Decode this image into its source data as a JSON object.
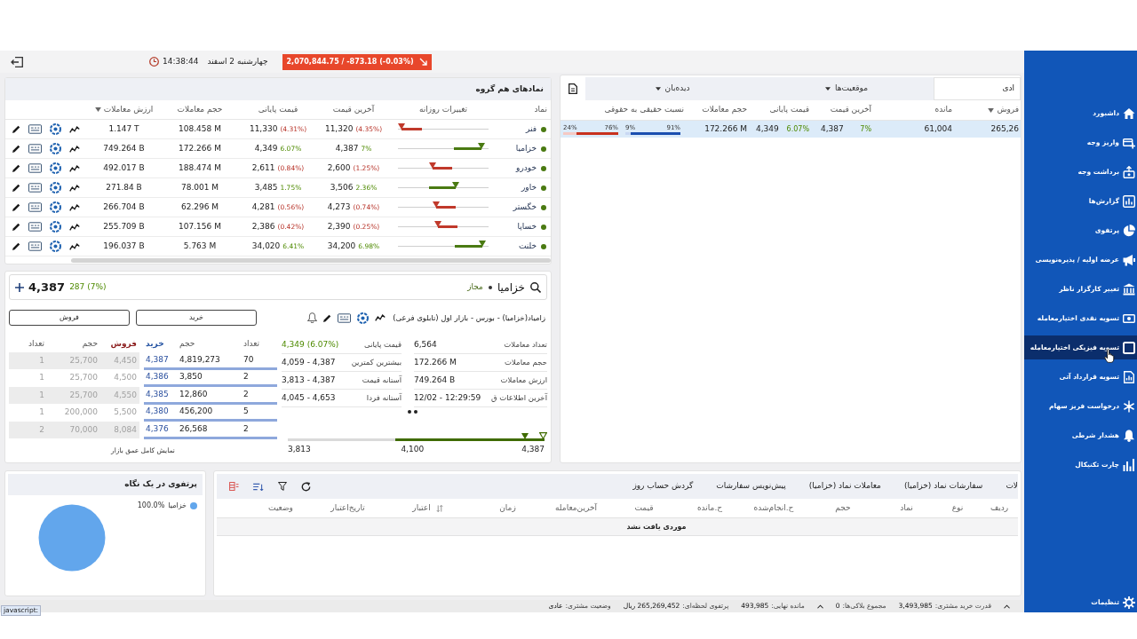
{
  "toolbar": {
    "time": "14:38:44",
    "date": "چهارشنبه 2 اسفند",
    "index": {
      "text": "2,070,844.75 / -873.18 (-0.03%)",
      "negative": true
    }
  },
  "peer_symbols": {
    "title": "نمادهای هم گروه",
    "columns": [
      {
        "label": "نماد",
        "sorted": false
      },
      {
        "label": "تغییرات روزانه",
        "sorted": false
      },
      {
        "label": "آخرین قیمت",
        "sorted": false
      },
      {
        "label": "قیمت پایانی",
        "sorted": false
      },
      {
        "label": "حجم معاملات",
        "sorted": false
      },
      {
        "label": "ارزش معاملات",
        "sorted": true
      }
    ],
    "rows": [
      {
        "symbol": "فنر",
        "negative": true,
        "level": 0.04,
        "last": "11,320",
        "last_change": "(4.35%)",
        "close": "11,330",
        "close_change": "(4.31%)",
        "volume": "108.458 M",
        "value": "1.147 T"
      },
      {
        "symbol": "خزامیا",
        "negative": false,
        "level": 0.92,
        "last": "4,387",
        "last_change": "7%",
        "close": "4,349",
        "close_change": "6.07%",
        "volume": "172.266 M",
        "value": "749.264 B"
      },
      {
        "symbol": "خودرو",
        "negative": true,
        "level": 0.38,
        "last": "2,600",
        "last_change": "(1.25%)",
        "close": "2,611",
        "close_change": "(0.84%)",
        "volume": "188.474 M",
        "value": "492.017 B"
      },
      {
        "symbol": "خاور",
        "negative": false,
        "level": 0.64,
        "last": "3,506",
        "last_change": "2.36%",
        "close": "3,485",
        "close_change": "1.75%",
        "volume": "78.001 M",
        "value": "271.84 B"
      },
      {
        "symbol": "خگستر",
        "negative": true,
        "level": 0.42,
        "last": "4,273",
        "last_change": "(0.74%)",
        "close": "4,281",
        "close_change": "(0.56%)",
        "volume": "62.296 M",
        "value": "266.704 B"
      },
      {
        "symbol": "خساپا",
        "negative": true,
        "level": 0.44,
        "last": "2,390",
        "last_change": "(0.25%)",
        "close": "2,386",
        "close_change": "(0.42%)",
        "volume": "107.156 M",
        "value": "255.709 B"
      },
      {
        "symbol": "خلنت",
        "negative": false,
        "level": 0.93,
        "last": "34,200",
        "last_change": "6.98%",
        "close": "34,020",
        "close_change": "6.41%",
        "volume": "5.763 M",
        "value": "196.037 B"
      }
    ]
  },
  "watchlist": {
    "tabs": [
      {
        "label": "ادی",
        "selected": true,
        "dropdown": false
      },
      {
        "label": "موقعیت‌ها",
        "selected": false,
        "dropdown": true
      },
      {
        "label": "دیده‌بان",
        "selected": false,
        "dropdown": true
      }
    ],
    "columns": [
      {
        "label": "فروش",
        "sorted": true
      },
      {
        "label": "مانده",
        "sorted": false
      },
      {
        "label": "آخرین قیمت",
        "sorted": false
      },
      {
        "label": "قیمت پایانی",
        "sorted": false
      },
      {
        "label": "حجم معاملات",
        "sorted": false
      },
      {
        "label": "نسبت حقیقی به حقوقی",
        "sorted": false
      }
    ],
    "rows": [
      {
        "selected": true,
        "negative": false,
        "sell": "265,26",
        "remaining": "61,004",
        "last": "4,387",
        "last_change": "7%",
        "close": "4,349",
        "close_change": "6.07%",
        "volume": "172.266 M",
        "buy_ratio": {
          "real": "91%",
          "legal": "9%",
          "level": 0.91
        },
        "sell_ratio": {
          "real": "76%",
          "legal": "24%",
          "level": 0.76
        }
      }
    ]
  },
  "symbol": {
    "name": "خزامیا",
    "status": "مجاز",
    "price": "4,387",
    "change": "287 (7%)",
    "negative": false,
    "full_name": "زامیاد(خزامیا) - بورس - بازار اول (تابلوی فرعی)",
    "buy_button": "خرید",
    "sell_button": "فروش",
    "order_book": {
      "columns": [
        "تعداد",
        "حجم",
        "خرید",
        "فروش",
        "حجم",
        "تعداد"
      ],
      "rows": [
        {
          "buy_count": "70",
          "buy_volume": "4,819,273",
          "buy_price": "4,387",
          "sell_price": "4,450",
          "sell_volume": "25,700",
          "sell_count": "1"
        },
        {
          "buy_count": "2",
          "buy_volume": "3,850",
          "buy_price": "4,386",
          "sell_price": "4,500",
          "sell_volume": "25,700",
          "sell_count": "1"
        },
        {
          "buy_count": "2",
          "buy_volume": "12,860",
          "buy_price": "4,385",
          "sell_price": "4,550",
          "sell_volume": "25,700",
          "sell_count": "1"
        },
        {
          "buy_count": "5",
          "buy_volume": "456,200",
          "buy_price": "4,380",
          "sell_price": "5,500",
          "sell_volume": "200,000",
          "sell_count": "1"
        },
        {
          "buy_count": "2",
          "buy_volume": "26,568",
          "buy_price": "4,376",
          "sell_price": "8,084",
          "sell_volume": "70,000",
          "sell_count": "2"
        }
      ],
      "link": "نمایش کامل عمق بازار"
    },
    "info": [
      {
        "label": "تعداد معاملات",
        "value": "6,564",
        "positive": false
      },
      {
        "label": "قیمت پایانی",
        "value": "4,349 (6.07%)",
        "positive": true
      },
      {
        "label": "حجم معاملات",
        "value": "172.266 M",
        "positive": false
      },
      {
        "label": "بیشترین کمترین",
        "value": "4,059 - 4,387",
        "positive": false
      },
      {
        "label": "ارزش معاملات",
        "value": "749.264 B",
        "positive": false
      },
      {
        "label": "آستانه قیمت",
        "value": "3,813 - 4,387",
        "positive": false
      },
      {
        "label": "آخرین اطلاعات ق",
        "value": "12/02 - 12:29:59",
        "positive": false
      },
      {
        "label": "آستانه فردا",
        "value": "4,045 - 4,653",
        "positive": false
      }
    ],
    "range": {
      "low": "3,813",
      "mid": "4,100",
      "high": "4,387",
      "level": 0.58
    }
  },
  "portfolio": {
    "title": "پرتفوی در یک نگاه",
    "legend": [
      {
        "label": "خزامیا",
        "value": "100.0%",
        "color": "#62a6ec"
      }
    ]
  },
  "orders": {
    "tabs": [
      "لات",
      "سفارشات نماد (خزامیا)",
      "معاملات نماد (خزامیا)",
      "پیش‌نویس سفارشات",
      "گردش حساب روز"
    ],
    "columns": [
      {
        "label": "ردیف",
        "sort_icon": false
      },
      {
        "label": "نوع",
        "sort_icon": false
      },
      {
        "label": "نماد",
        "sort_icon": false
      },
      {
        "label": "حجم",
        "sort_icon": false
      },
      {
        "label": "ح.انجام‌شده",
        "sort_icon": false
      },
      {
        "label": "ح.مانده",
        "sort_icon": false
      },
      {
        "label": "قیمت",
        "sort_icon": false
      },
      {
        "label": "آخرین‌معامله",
        "sort_icon": false
      },
      {
        "label": "زمان",
        "sort_icon": false
      },
      {
        "label": "اعتبار",
        "sort_icon": true
      },
      {
        "label": "تاریخ‌اعتبار",
        "sort_icon": false
      },
      {
        "label": "وضعیت",
        "sort_icon": false
      }
    ],
    "empty_text": "موردی یافت نشد"
  },
  "status_bar": [
    {
      "kind": "caret"
    },
    {
      "kind": "pair",
      "label": "قدرت خرید مشتری:",
      "value": "3,493,985"
    },
    {
      "kind": "pair",
      "label": "مجموع بلاکی‌ها:",
      "value": "0"
    },
    {
      "kind": "caret"
    },
    {
      "kind": "pair",
      "label": "مانده نهایی:",
      "value": "493,985"
    },
    {
      "kind": "pair",
      "label": "پرتفوی لحظه‌ای:",
      "value": "265,269,452 ریال"
    },
    {
      "kind": "pair",
      "label": "وضعیت مشتری:",
      "value": "عادی"
    }
  ],
  "browser_status": "javascript:",
  "sidebar": {
    "items": [
      {
        "label": "داشبورد",
        "selected": false
      },
      {
        "label": "واریز وجه",
        "selected": false
      },
      {
        "label": "برداشت وجه",
        "selected": false
      },
      {
        "label": "گزارش‌ها",
        "selected": false
      },
      {
        "label": "پرتفوی",
        "selected": false
      },
      {
        "label": "عرضه اولیه / پذیره‌نویسی",
        "selected": false
      },
      {
        "label": "تغییر کارگزار ناظر",
        "selected": false
      },
      {
        "label": "تسویه نقدی اختیارمعامله",
        "selected": false
      },
      {
        "label": "تسویه فیزیکی اختیارمعامله",
        "selected": true
      },
      {
        "label": "تسویه قرارداد آتی",
        "selected": false
      },
      {
        "label": "درخواست فریز سهام",
        "selected": false
      },
      {
        "label": "هشدار شرطی",
        "selected": false
      },
      {
        "label": "چارت تکنیکال",
        "selected": false
      }
    ],
    "settings": "تنظیمات"
  }
}
